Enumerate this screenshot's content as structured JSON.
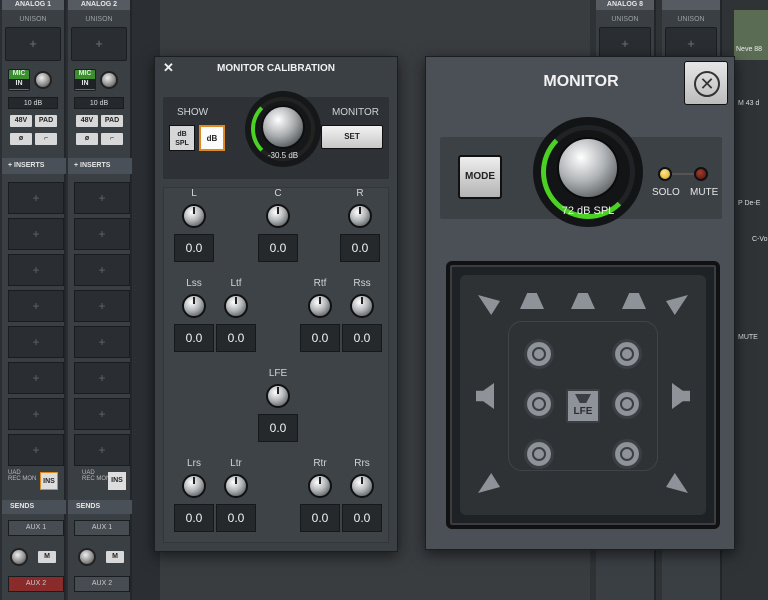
{
  "console": {
    "strips": [
      {
        "name": "ANALOG 1",
        "unison": "UNISON",
        "slot": "+",
        "mic": "MIC",
        "in": "IN",
        "gain": "10 dB",
        "b48": "48V",
        "pad": "PAD",
        "phase": "ø"
      },
      {
        "name": "ANALOG 2",
        "unison": "UNISON",
        "slot": "+",
        "mic": "MIC",
        "in": "IN",
        "gain": "10 dB",
        "b48": "48V",
        "pad": "PAD",
        "phase": "ø"
      }
    ],
    "inserts_label": "INSERTS",
    "insert_slot": "+",
    "uad": "UAD",
    "rec": "REC",
    "mon": "MON",
    "ins": "INS",
    "sends_label": "SENDS",
    "aux1": "AUX 1",
    "aux2": "AUX 2",
    "m": "M",
    "right_strip": {
      "name": "ANALOG 8",
      "unison": "UNISON",
      "plugin": "Neve 88",
      "gain": "M 43 d",
      "p_de": "P De-E",
      "c_vo": "C-Vo",
      "mute": "MUTE"
    }
  },
  "calibration": {
    "title": "MONITOR CALIBRATION",
    "close_glyph": "✕",
    "show_label": "SHOW",
    "monitor_label": "MONITOR",
    "btn_dbspl_1": "dB",
    "btn_dbspl_2": "SPL",
    "btn_db": "dB",
    "btn_set": "SET",
    "knob_value": "-30.5 dB",
    "channels": [
      {
        "label": "L",
        "value": "0.0"
      },
      {
        "label": "C",
        "value": "0.0"
      },
      {
        "label": "R",
        "value": "0.0"
      },
      {
        "label": "Lss",
        "value": "0.0"
      },
      {
        "label": "Ltf",
        "value": "0.0"
      },
      {
        "label": "Rtf",
        "value": "0.0"
      },
      {
        "label": "Rss",
        "value": "0.0"
      },
      {
        "label": "LFE",
        "value": "0.0"
      },
      {
        "label": "Lrs",
        "value": "0.0"
      },
      {
        "label": "Ltr",
        "value": "0.0"
      },
      {
        "label": "Rtr",
        "value": "0.0"
      },
      {
        "label": "Rrs",
        "value": "0.0"
      }
    ]
  },
  "monitor": {
    "title": "MONITOR",
    "close_glyph": "✕",
    "mode": "MODE",
    "knob_value": "72 dB SPL",
    "solo": "SOLO",
    "mute": "MUTE",
    "lfe": "LFE"
  }
}
